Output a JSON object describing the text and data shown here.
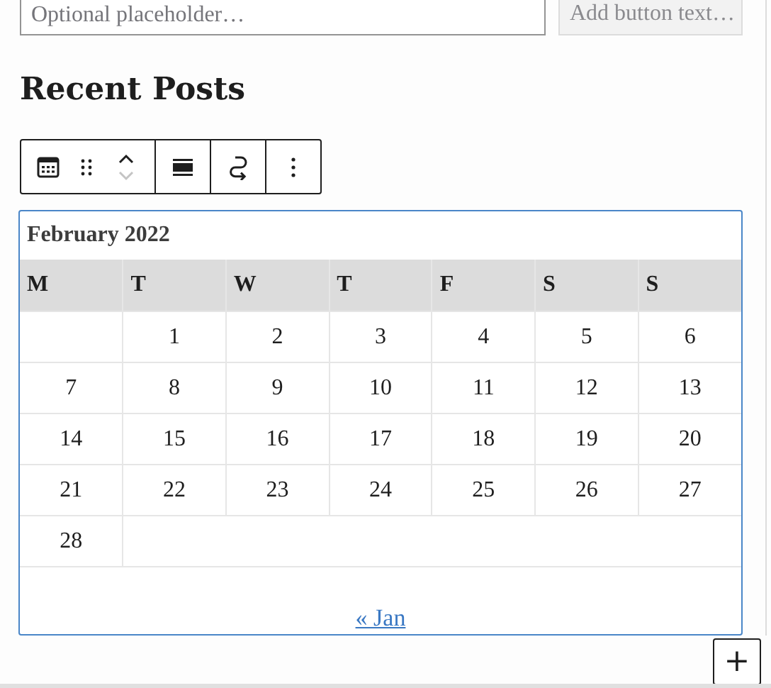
{
  "search_form": {
    "placeholder": "Optional placeholder…",
    "button_placeholder": "Add button text…"
  },
  "heading": "Recent Posts",
  "toolbar": {
    "mover": {
      "up_disabled": false,
      "down_disabled": true
    }
  },
  "calendar": {
    "caption": "February 2022",
    "weekdays": [
      "M",
      "T",
      "W",
      "T",
      "F",
      "S",
      "S"
    ],
    "weeks": [
      {
        "starts_midweek": true,
        "days": [
          "1",
          "2",
          "3",
          "4",
          "5",
          "6"
        ]
      },
      {
        "starts_midweek": false,
        "days": [
          "7",
          "8",
          "9",
          "10",
          "11",
          "12",
          "13"
        ]
      },
      {
        "starts_midweek": false,
        "days": [
          "14",
          "15",
          "16",
          "17",
          "18",
          "19",
          "20"
        ]
      },
      {
        "starts_midweek": false,
        "days": [
          "21",
          "22",
          "23",
          "24",
          "25",
          "26",
          "27"
        ]
      },
      {
        "starts_midweek": false,
        "days": [
          "28"
        ]
      }
    ],
    "prev_link": "« Jan"
  },
  "add_block": "+"
}
